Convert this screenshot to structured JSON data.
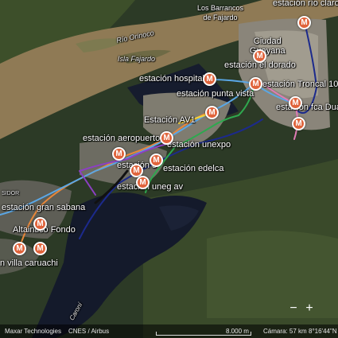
{
  "places": {
    "los_barrancos": "Los Barrancos\nde Fajardo",
    "rio_orinoco": "Río Orinoco",
    "isla_fajardo": "Isla Fajardo",
    "ciudad_guayana": "Ciudad\nGuayana",
    "sidor": "SIDOR",
    "caroni": "Caroní"
  },
  "stations": [
    {
      "name": "estación río claro"
    },
    {
      "name": "estación el dorado"
    },
    {
      "name": "estación hospital"
    },
    {
      "name": "estación Troncal 10"
    },
    {
      "name": "estación punta vista"
    },
    {
      "name": "estación fca Duarte"
    },
    {
      "name": "Estación AV1"
    },
    {
      "name": "estación aeropuerto"
    },
    {
      "name": "estación unexpo"
    },
    {
      "name": "estación 3"
    },
    {
      "name": "estación edelca"
    },
    {
      "name": "estación uneg av"
    },
    {
      "name": "estación gran sabana"
    },
    {
      "name": "Altaintico Fondo"
    },
    {
      "name": "n villa caruachi"
    }
  ],
  "marker_glyph": "M",
  "zoom": {
    "out": "−",
    "in": "+"
  },
  "attribution": {
    "provider": "Maxar Technologies",
    "sources": "CNES / Airbus",
    "scale": "8.000 m",
    "camera": "Cámara: 57 km",
    "coords": "8°16'44\"N"
  },
  "route_colors": {
    "green": "#2fa84f",
    "blue_dark": "#1c2a8c",
    "blue_light": "#5aa7e6",
    "orange": "#e8873a",
    "purple": "#8d3fc4",
    "yellow": "#f2d23b",
    "pink": "#e07bb6",
    "black": "#111111"
  }
}
